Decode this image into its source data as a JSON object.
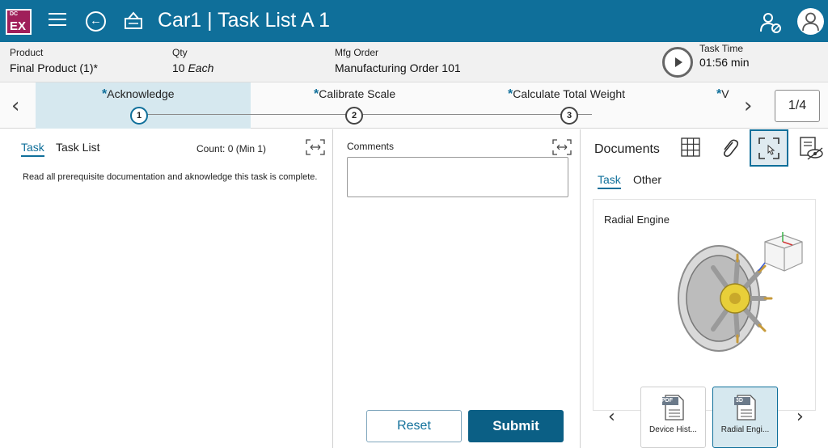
{
  "app": {
    "logo": {
      "small": "DC",
      "big": "EX"
    },
    "title": "Car1 | Task List A 1",
    "icons": {
      "menu": "hamburger-icon",
      "back": "back-arrow-icon",
      "kit": "kit-basket-icon",
      "user_settings": "user-settings-icon",
      "avatar": "user-avatar-icon"
    }
  },
  "info": {
    "product_label": "Product",
    "product_value": "Final Product (1)*",
    "qty_label": "Qty",
    "qty_number": "10",
    "qty_unit": "Each",
    "mfg_label": "Mfg Order",
    "mfg_value": "Manufacturing Order 101",
    "task_time_label": "Task Time",
    "task_time_value": "01:56 min"
  },
  "steps": {
    "items": [
      {
        "label": "Acknowledge",
        "number": "1",
        "active": true
      },
      {
        "label": "Calibrate Scale",
        "number": "2",
        "active": false
      },
      {
        "label": "Calculate Total Weight",
        "number": "3",
        "active": false
      },
      {
        "label": "V",
        "number": "",
        "active": false
      }
    ],
    "star": "*",
    "prev": "‹",
    "next": "›",
    "page": "1/4"
  },
  "task_panel": {
    "tab_task": "Task",
    "tab_list": "Task List",
    "count": "Count: 0 (Min 1)",
    "instruction": "Read all prerequisite documentation and aknowledge this task is complete."
  },
  "comments": {
    "label": "Comments",
    "value": "",
    "reset": "Reset",
    "submit": "Submit"
  },
  "documents": {
    "title": "Documents",
    "tab_task": "Task",
    "tab_other": "Other",
    "viewer_title": "Radial Engine",
    "thumbs": [
      {
        "badge": "PDF",
        "label": "Device Hist..."
      },
      {
        "badge": "3D",
        "label": "Radial Engi..."
      }
    ],
    "prev": "‹",
    "next": "›",
    "colors": {
      "accent": "#0f6f9a",
      "topbar": "#0f6f9a",
      "logo": "#a01f5a"
    }
  }
}
